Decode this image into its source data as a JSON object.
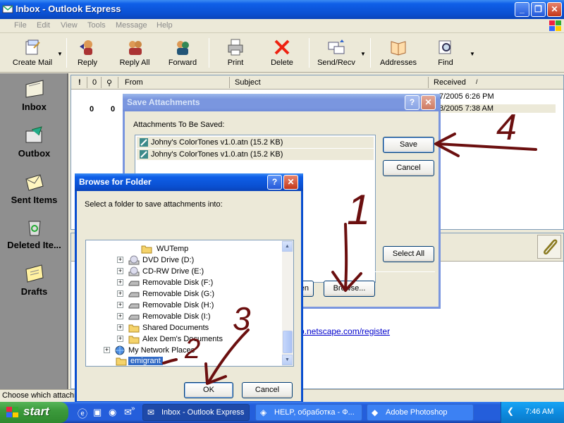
{
  "window": {
    "title": "Inbox - Outlook Express"
  },
  "menu": [
    "File",
    "Edit",
    "View",
    "Tools",
    "Message",
    "Help"
  ],
  "toolbar": [
    "Create Mail",
    "Reply",
    "Reply All",
    "Forward",
    "Print",
    "Delete",
    "Send/Recv",
    "Addresses",
    "Find"
  ],
  "outlook_bar": [
    "Inbox",
    "Outbox",
    "Sent Items",
    "Deleted Ite...",
    "Drafts"
  ],
  "message_list": {
    "columns": {
      "from": "From",
      "subject": "Subject",
      "received": "Received"
    },
    "received": [
      "7/2005 6:26 PM",
      "8/2005 7:38 AM"
    ],
    "attach_mark": "0"
  },
  "preview": {
    "link": "p.netscape.com/register"
  },
  "status_text": "Choose which attachm",
  "save_attachments": {
    "title": "Save Attachments",
    "label": "Attachments To Be Saved:",
    "files": [
      "Johny's ColorTones v1.0.atn (15.2 KB)",
      "Johny's ColorTones v1.0.atn (15.2 KB)"
    ],
    "save": "Save",
    "cancel": "Cancel",
    "select_all": "Select All",
    "browse": "Browse...",
    "open_partial": "en"
  },
  "browse_folder": {
    "title": "Browse for Folder",
    "prompt": "Select a folder to save attachments into:",
    "tree": [
      "WUTemp",
      "DVD Drive (D:)",
      "CD-RW Drive (E:)",
      "Removable Disk (F:)",
      "Removable Disk (G:)",
      "Removable Disk (H:)",
      "Removable Disk (I:)",
      "Shared Documents",
      "Alex Dem's Documents",
      "My Network Places",
      "emigrant"
    ],
    "ok": "OK",
    "cancel": "Cancel"
  },
  "annotations": [
    "1",
    "2",
    "3",
    "4"
  ],
  "taskbar": {
    "start": "start",
    "tasks": [
      "Inbox - Outlook Express",
      "HELP, обработка - Ф...",
      "Adobe Photoshop"
    ],
    "clock": "7:46 AM"
  },
  "colors": {
    "title_blue": "#0a4fd0",
    "annotation_red": "#6b0f0f",
    "start_green": "#3c9a3c"
  }
}
